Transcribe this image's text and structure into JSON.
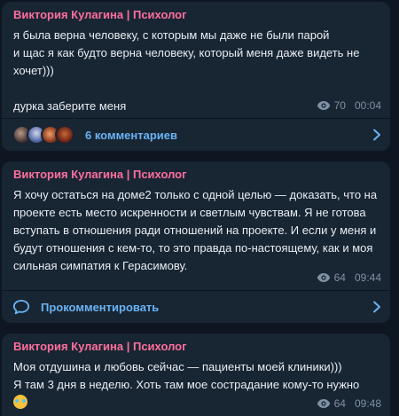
{
  "messages": [
    {
      "author": "Виктория Кулагина | Психолог",
      "text": "я была верна человеку, с которым мы даже не были парой\nи щас я как будто верна человеку, который меня даже видеть не хочет)))\n\nдурка заберите меня",
      "views": "70",
      "time": "00:04",
      "comments_label": "6 комментариев"
    },
    {
      "author": "Виктория Кулагина | Психолог",
      "text": "Я хочу остаться на доме2 только с одной целью — доказать, что на проекте есть место искренности и светлым чувствам. Я не готова вступать в отношения ради отношений на проекте. И если у меня и будут отношения с кем-то, то это правда по-настоящему, как и моя сильная симпатия к Герасимову.",
      "views": "64",
      "time": "09:44",
      "comments_label": "Прокомментировать"
    },
    {
      "author": "Виктория Кулагина | Психолог",
      "text": "Моя отдушина и любовь сейчас — пациенты моей клиники)))\nЯ там 3 дня в неделю. Хоть там мое сострадание кому-то нужно",
      "emoji": "crying-laughing-emoji",
      "views": "64",
      "time": "09:48"
    }
  ],
  "colors": {
    "background": "#0e1621",
    "bubble": "#182533",
    "author": "#ff6f9d",
    "link": "#6ab3f3",
    "meta": "#7f91a4"
  },
  "icons": [
    "eye-icon",
    "chevron-right-icon",
    "comment-icon"
  ]
}
